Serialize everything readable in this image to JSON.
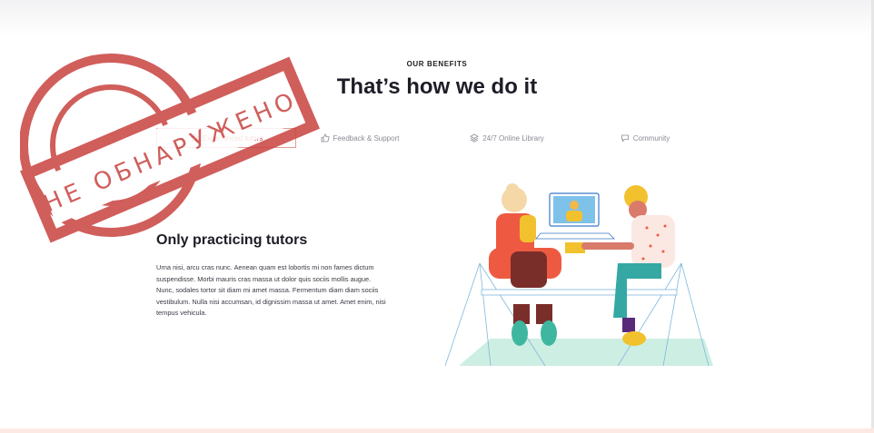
{
  "section": {
    "eyebrow": "OUR BENEFITS",
    "title": "That’s how we do it"
  },
  "tabs": [
    {
      "label": "Experienced tutors",
      "icon": "star-icon",
      "active": true
    },
    {
      "label": "Feedback & Support",
      "icon": "thumbs-up-icon",
      "active": false
    },
    {
      "label": "24/7 Online Library",
      "icon": "layers-icon",
      "active": false
    },
    {
      "label": "Community",
      "icon": "chat-icon",
      "active": false
    }
  ],
  "content": {
    "heading": "Only practicing tutors",
    "body": "Urna nisi, arcu cras nunc. Aenean quam est lobortis mi non fames dictum suspendisse. Morbi mauris cras massa ut dolor quis sociis mollis augue. Nunc, sodales tortor sit diam mi amet massa. Fermentum diam diam sociis vestibulum. Nulla nisi accumsan, id dignissim massa ut amet. Amet enim, nisi tempus vehicula."
  },
  "stamp": {
    "text": "НЕ ОБНАРУЖЕНО",
    "color": "#c8433f"
  },
  "colors": {
    "accent": "#c0504a",
    "heading": "#1d1d27"
  }
}
